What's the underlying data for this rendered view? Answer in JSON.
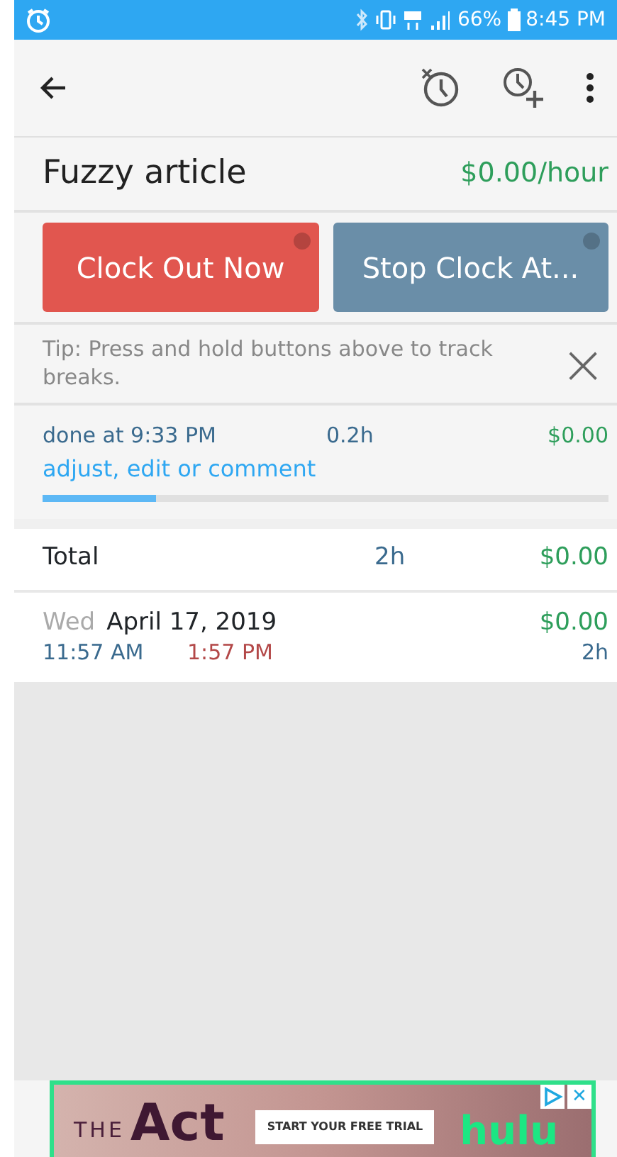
{
  "status_bar": {
    "battery": "66%",
    "time": "8:45 PM"
  },
  "job": {
    "title": "Fuzzy article",
    "rate": "$0.00/hour"
  },
  "buttons": [
    {
      "label": "Clock Out Now",
      "kind": "danger"
    },
    {
      "label": "Stop Clock At...",
      "kind": "secondary"
    }
  ],
  "tip": {
    "text": "Tip: Press and hold buttons above to track breaks.",
    "close": "×"
  },
  "current_entry": {
    "status": "done at 9:33 PM",
    "hours": "0.2h",
    "amount": "$0.00",
    "link": "adjust, edit or comment",
    "level": 0.2
  },
  "total": {
    "label": "Total",
    "hours": "2h",
    "amount": "$0.00"
  },
  "days": [
    {
      "weekday": "Wed",
      "date": "April 17, 2019",
      "amount": "$0.00",
      "start": "11:57 AM",
      "end": "1:57 PM",
      "hours": "2h"
    }
  ],
  "ad": {
    "title_small": "THE",
    "title_big": "Act",
    "cta": "START YOUR FREE TRIAL",
    "brand": "hulu",
    "close": "✕"
  }
}
